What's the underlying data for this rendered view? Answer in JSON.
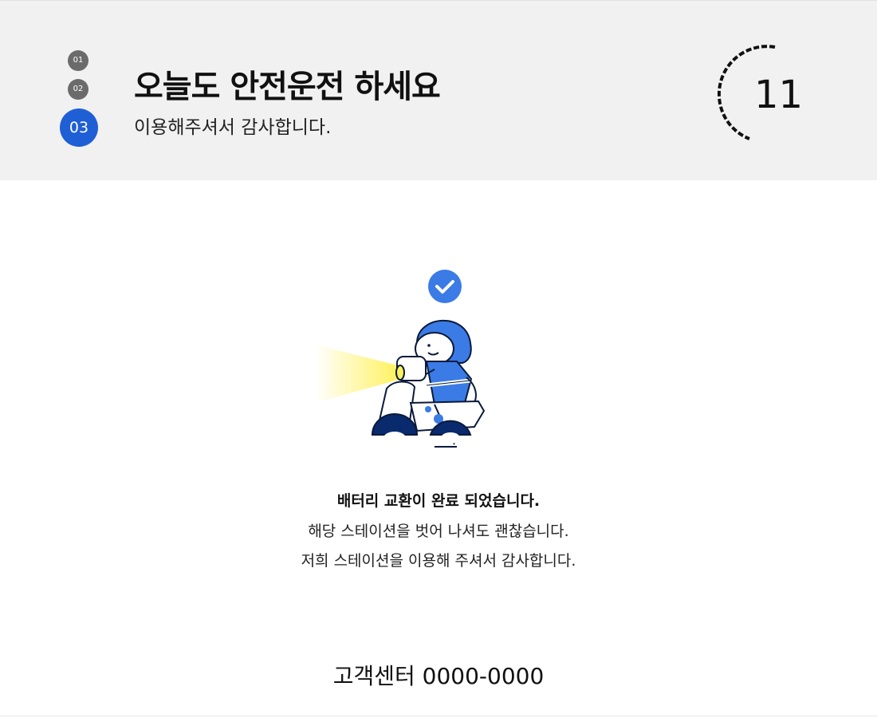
{
  "header": {
    "steps": [
      "01",
      "02",
      "03"
    ],
    "active_step": "03",
    "title": "오늘도 안전운전 하세요",
    "subtitle": "이용해주셔서 감사합니다.",
    "countdown": "11"
  },
  "main": {
    "illustration_icon": "scooter-rider-icon",
    "check_icon": "check-circle-icon",
    "message_title": "배터리 교환이 완료 되었습니다.",
    "message_line1": "해당 스테이션을 벗어 나셔도 괜찮습니다.",
    "message_line2": "저희 스테이션을 이용해 주셔서 감사합니다."
  },
  "footer": {
    "support": "고객센터 0000-0000"
  },
  "colors": {
    "accent": "#1f5fd6",
    "header_bg": "#f1f1f1",
    "step_inactive": "#6b6b6b",
    "helmet": "#3a7be6",
    "headlight": "#fff36b"
  }
}
